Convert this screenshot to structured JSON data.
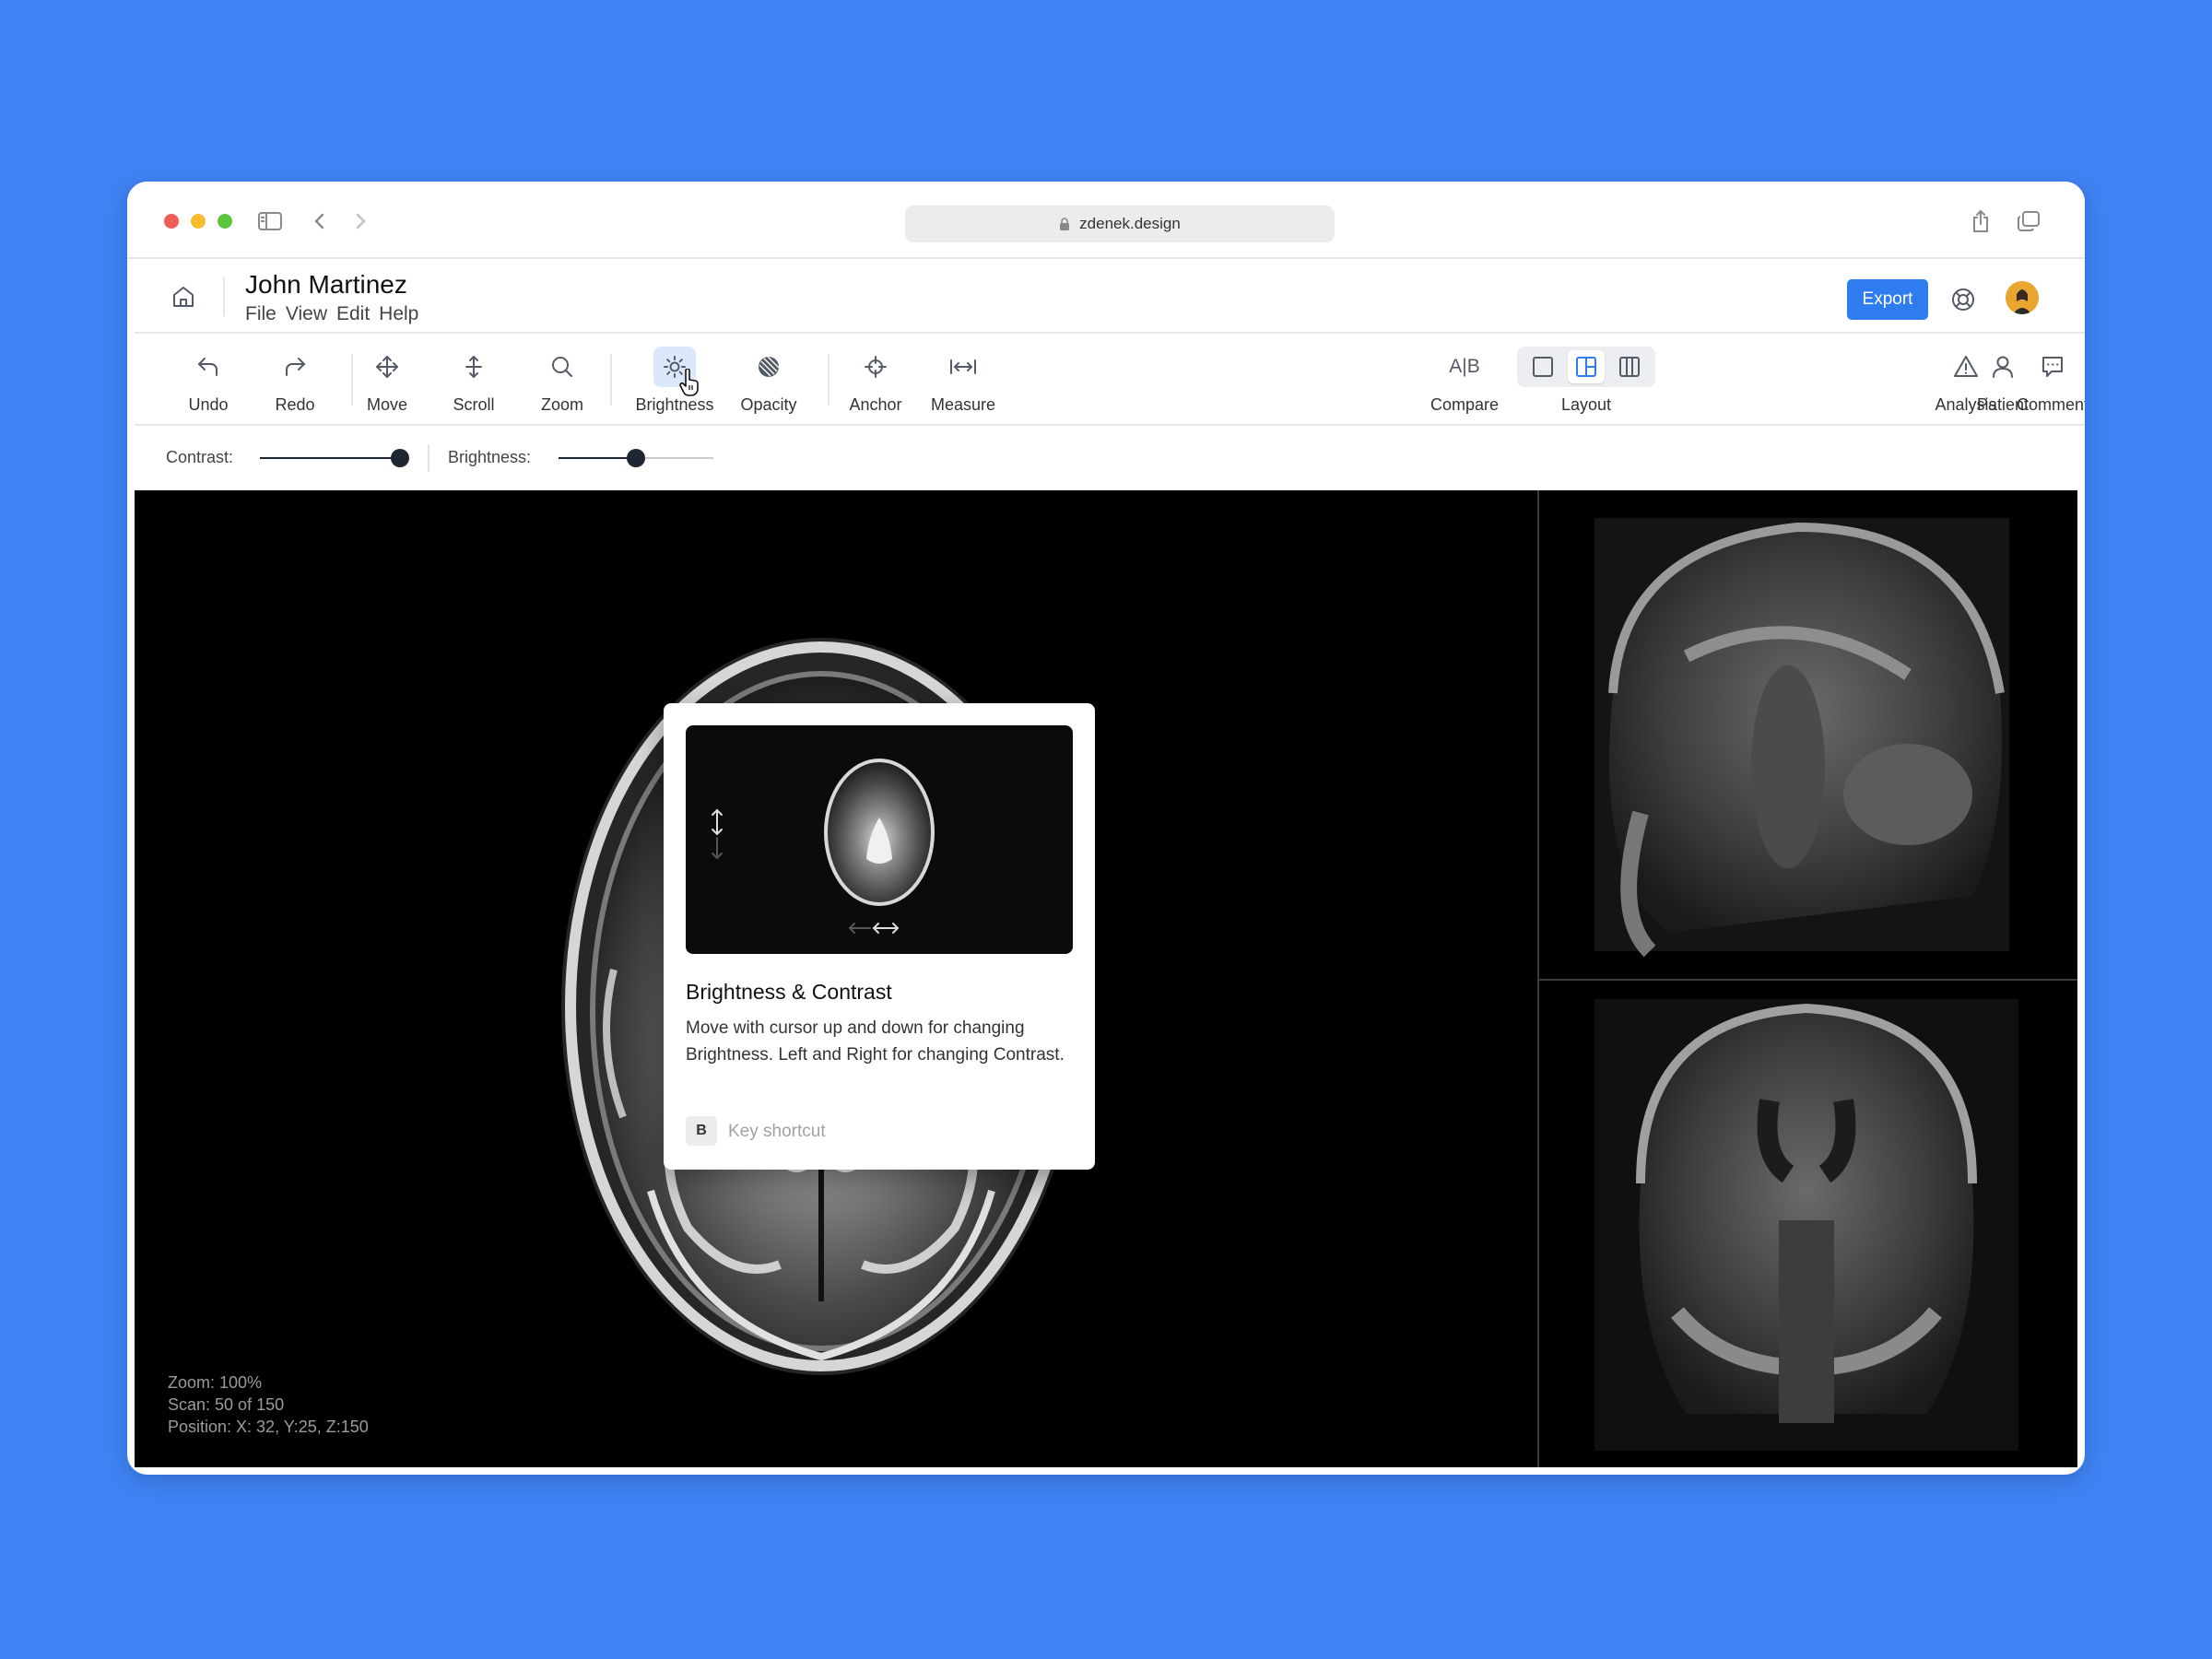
{
  "browser": {
    "url": "zdenek.design",
    "traffic_lights": [
      "#ee5f57",
      "#f5bd2e",
      "#5ec43b"
    ]
  },
  "header": {
    "patient_name": "John Martinez",
    "menu": [
      "File",
      "View",
      "Edit",
      "Help"
    ],
    "export_label": "Export",
    "accent_color": "#2f7bf0"
  },
  "toolbar": {
    "undo": "Undo",
    "redo": "Redo",
    "move": "Move",
    "scroll": "Scroll",
    "zoom": "Zoom",
    "brightness": "Brightness",
    "opacity": "Opacity",
    "anchor": "Anchor",
    "measure": "Measure",
    "compare": "Compare",
    "layout": "Layout",
    "analysis": "Analysis",
    "comment": "Comment",
    "patient": "Patient",
    "active_tool": "brightness",
    "active_layout": "split"
  },
  "sliders": {
    "contrast_label": "Contrast:",
    "contrast_value": 0.95,
    "brightness_label": "Brightness:",
    "brightness_value": 0.5
  },
  "viewer": {
    "zoom": "Zoom: 100%",
    "scan": "Scan: 50 of 150",
    "position": "Position: X: 32, Y:25, Z:150"
  },
  "tooltip": {
    "title": "Brightness & Contrast",
    "description": "Move with cursor up and down for changing Brightness. Left and Right for changing Contrast.",
    "key": "B",
    "key_label": "Key shortcut"
  }
}
